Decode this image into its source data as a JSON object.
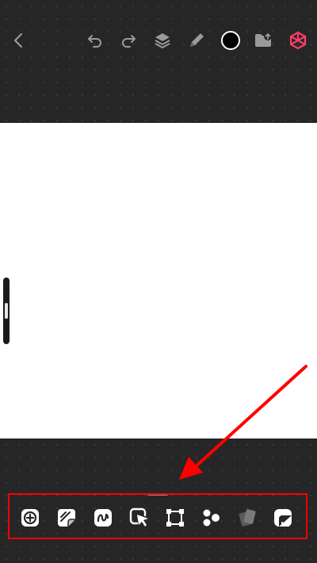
{
  "topbar": {
    "icons": [
      "back-chevron-icon",
      "undo-icon",
      "redo-icon",
      "layers-icon",
      "pen-icon",
      "color-swatch",
      "folder-upload-icon",
      "app-logo-icon"
    ],
    "current_color": "#000000",
    "accent_color": "#ff3d6b"
  },
  "tools": {
    "icons": [
      "add-icon",
      "sticker-icon",
      "squiggle-icon",
      "select-pointer-icon",
      "transform-frame-icon",
      "shapes-icon",
      "cards-icon",
      "ruler-icon"
    ]
  },
  "annotation": {
    "highlight_color": "#ff0000"
  }
}
